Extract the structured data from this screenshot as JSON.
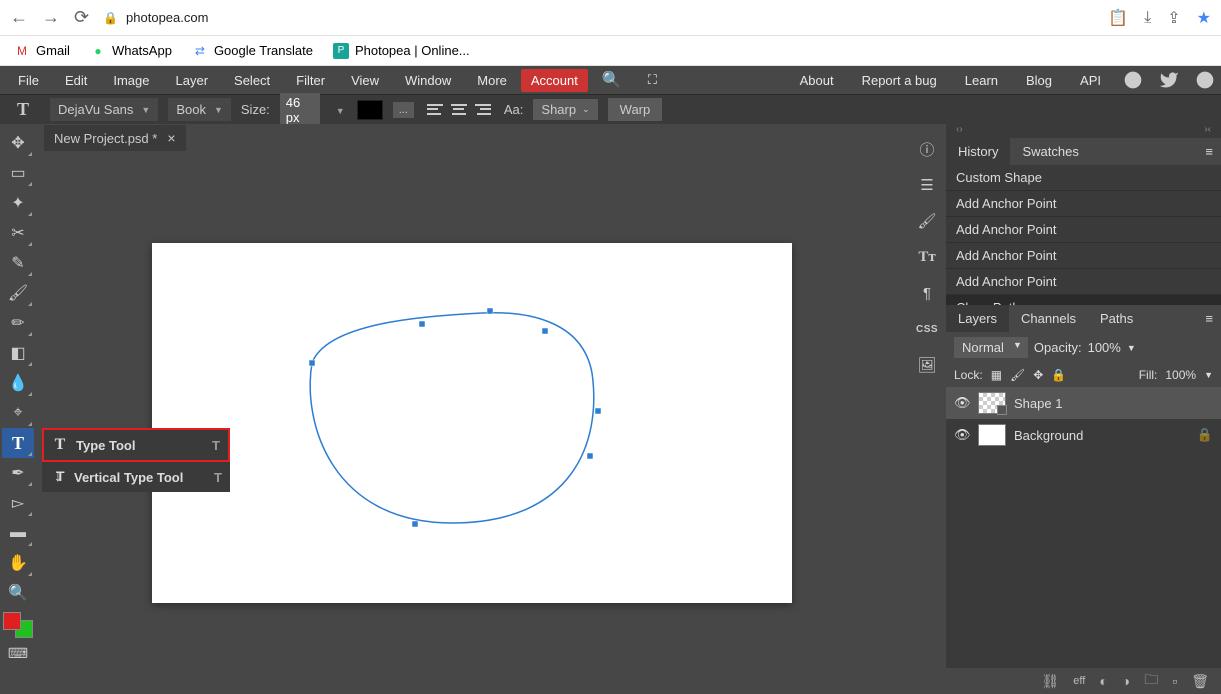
{
  "browser": {
    "url": "photopea.com",
    "bookmarks": [
      {
        "icon": "gmail",
        "label": "Gmail"
      },
      {
        "icon": "whatsapp",
        "label": "WhatsApp"
      },
      {
        "icon": "gtranslate",
        "label": "Google Translate"
      },
      {
        "icon": "photopea",
        "label": "Photopea | Online..."
      }
    ]
  },
  "menu": {
    "items": [
      "File",
      "Edit",
      "Image",
      "Layer",
      "Select",
      "Filter",
      "View",
      "Window",
      "More"
    ],
    "account": "Account",
    "right": [
      "About",
      "Report a bug",
      "Learn",
      "Blog",
      "API"
    ]
  },
  "type_toolbar": {
    "font": "DejaVu Sans",
    "weight": "Book",
    "size_label": "Size:",
    "size": "46 px",
    "aa_label": "Aa:",
    "aa": "Sharp",
    "warp": "Warp"
  },
  "document": {
    "tab": "New Project.psd *"
  },
  "type_popup": {
    "items": [
      {
        "label": "Type Tool",
        "shortcut": "T"
      },
      {
        "label": "Vertical Type Tool",
        "shortcut": "T"
      }
    ]
  },
  "right_tabs": {
    "history": "History",
    "swatches": "Swatches",
    "layers": "Layers",
    "channels": "Channels",
    "paths": "Paths"
  },
  "history": [
    "Custom Shape",
    "Add Anchor Point",
    "Add Anchor Point",
    "Add Anchor Point",
    "Add Anchor Point",
    "Close Path"
  ],
  "layers_panel": {
    "blend": "Normal",
    "opacity_label": "Opacity:",
    "opacity": "100%",
    "lock_label": "Lock:",
    "fill_label": "Fill:",
    "fill": "100%",
    "items": [
      {
        "name": "Shape 1"
      },
      {
        "name": "Background"
      }
    ],
    "footer_eff": "eff"
  }
}
